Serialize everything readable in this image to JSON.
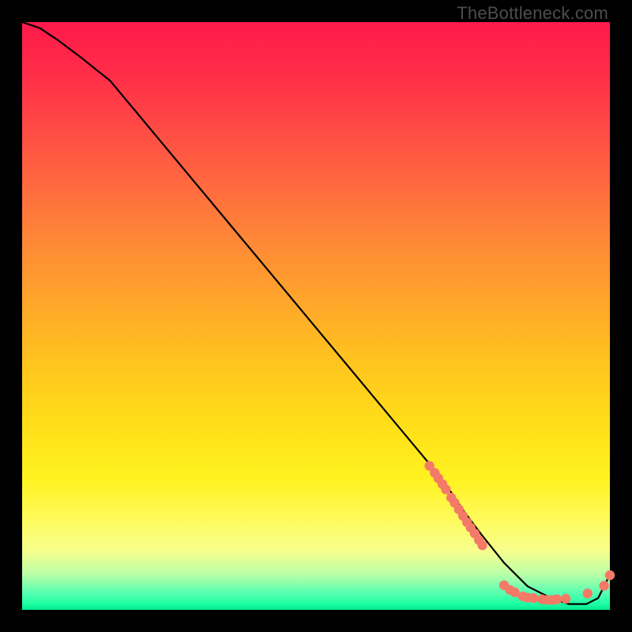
{
  "watermark": "TheBottleneck.com",
  "chart_data": {
    "type": "line",
    "title": "",
    "xlabel": "",
    "ylabel": "",
    "xlim": [
      0,
      100
    ],
    "ylim": [
      0,
      100
    ],
    "grid": false,
    "curve": {
      "name": "bottleneck-curve",
      "x": [
        0,
        3,
        6,
        10,
        15,
        20,
        25,
        30,
        35,
        40,
        45,
        50,
        55,
        60,
        65,
        70,
        73,
        75,
        78,
        82,
        86,
        90,
        93,
        96,
        98,
        99,
        100
      ],
      "y": [
        100,
        99,
        97,
        94,
        90,
        84,
        78,
        72,
        66,
        60,
        54,
        48,
        42,
        36,
        30,
        24,
        20,
        17,
        13,
        8,
        4,
        2,
        1,
        1,
        2,
        4,
        6
      ]
    },
    "clusters": [
      {
        "name": "cluster-diagonal",
        "x": [
          69.3,
          70.2,
          70.8,
          71.5,
          72.1,
          73.0,
          73.6,
          74.3,
          75.0,
          75.7,
          76.3,
          77.0,
          77.7,
          78.3
        ],
        "y": [
          24.5,
          23.3,
          22.4,
          21.4,
          20.5,
          19.1,
          18.2,
          17.1,
          16.0,
          14.9,
          14.0,
          13.0,
          11.9,
          11.0
        ]
      },
      {
        "name": "cluster-valley",
        "x": [
          82.0,
          83.0,
          83.8,
          85.2,
          86.0,
          87.0,
          88.5,
          89.4,
          90.2,
          91.0,
          92.5,
          96.2
        ],
        "y": [
          4.2,
          3.4,
          3.0,
          2.3,
          2.1,
          2.0,
          1.8,
          1.7,
          1.7,
          1.8,
          1.9,
          2.8
        ]
      },
      {
        "name": "cluster-tail",
        "x": [
          99.0,
          100.0
        ],
        "y": [
          4.1,
          5.9
        ]
      }
    ],
    "marker_color": "#f47a68",
    "curve_color": "#000000"
  }
}
